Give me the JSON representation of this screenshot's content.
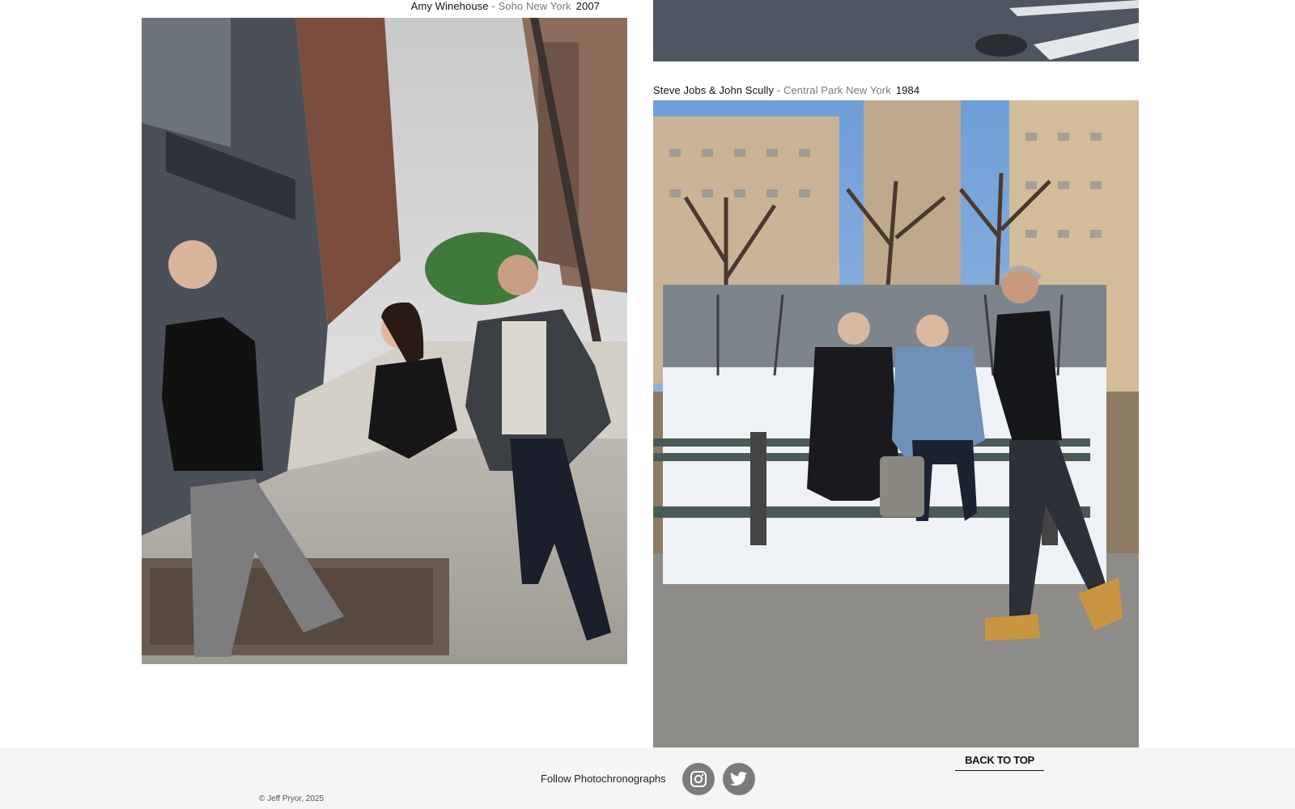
{
  "captions": {
    "amy": {
      "subject": "Amy Winehouse",
      "separator": " - ",
      "place": "Soho New York",
      "year": "2007"
    },
    "jobs": {
      "subject": "Steve Jobs & John Scully",
      "separator": " - ",
      "place": "Central Park New York",
      "year": "1984"
    }
  },
  "footer": {
    "follow_label": "Follow Photochronographs",
    "back_to_top_label": "BACK TO TOP",
    "copyright": "© Jeff Pryor, 2025"
  },
  "icons": {
    "instagram": "instagram-icon",
    "twitter": "twitter-icon"
  },
  "colors": {
    "footer_bg": "#f5f5f5",
    "social_bg": "#7b7b7b",
    "caption_muted": "#7a7a7a"
  }
}
